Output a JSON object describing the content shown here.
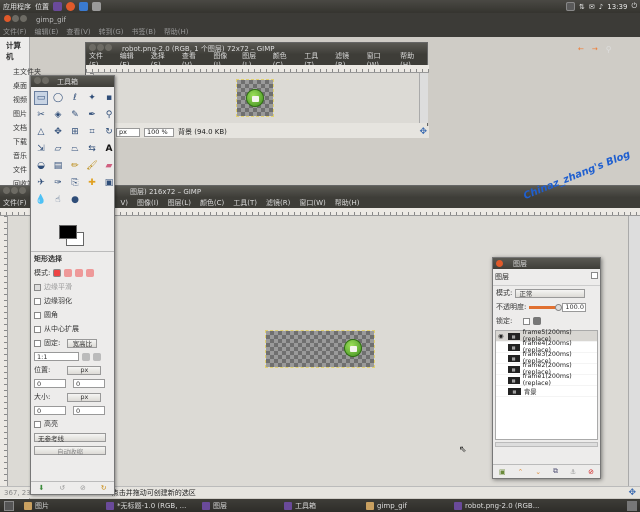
{
  "top_panel": {
    "apps": "应用程序",
    "places": "位置",
    "time": "13:39"
  },
  "bg_window": {
    "title": "gimp_gif",
    "menus": [
      "文件(F)",
      "编辑(E)",
      "查看(V)",
      "转到(G)",
      "书签(B)",
      "帮助(H)"
    ]
  },
  "file_manager": {
    "header": "计算机",
    "items": [
      "主文件夹",
      "桌面",
      "视频",
      "图片",
      "文档",
      "下载",
      "音乐",
      "文件",
      "回收站"
    ],
    "network": "网络"
  },
  "small_window": {
    "title": "robot.png-2.0 (RGB, 1 个图层) 72x72 – GIMP",
    "menus": [
      "文件(F)",
      "编辑(E)",
      "选择(S)",
      "查看(V)",
      "图像(I)",
      "图层(L)",
      "颜色(C)",
      "工具(T)",
      "滤镜(R)",
      "窗口(W)",
      "帮助(H)"
    ],
    "unit": "px",
    "zoom": "100 %",
    "status": "背景 (94.0 KB)"
  },
  "main_window": {
    "title": "图层) 216x72 – GIMP",
    "menus": [
      "文件(F)",
      "V)",
      "图像(I)",
      "图层(L)",
      "颜色(C)",
      "工具(T)",
      "滤镜(R)",
      "窗口(W)",
      "帮助(H)"
    ],
    "coords": "367, 23",
    "status": "点击并拖动可创建新的选区"
  },
  "watermark": "Chinaz_zhang's Blog",
  "toolbox": {
    "title": "工具箱",
    "colors": {
      "fg": "#000000",
      "bg": "#ffffff"
    },
    "options": {
      "title": "矩形选择",
      "mode": "模式:",
      "antialias": "边缘平滑",
      "feather": "边缘羽化",
      "rounded": "圆角",
      "expand": "从中心扩展",
      "fixed": "固定:",
      "fixed_value": "宽高比",
      "ratio": "1:1",
      "position": "位置:",
      "pos_unit": "px",
      "pos_x": "0",
      "pos_y": "0",
      "size": "大小:",
      "size_unit": "px",
      "size_w": "0",
      "size_h": "0",
      "highlight": "高亮",
      "guides": "无参考线",
      "autoshrink": "自动收缩"
    }
  },
  "layers_dock": {
    "title": "图层",
    "tab": "图层",
    "mode_label": "模式:",
    "mode_value": "正常",
    "opacity_label": "不透明度:",
    "opacity_value": "100.0",
    "opacity": 1.0,
    "lock_label": "锁定:",
    "layers": [
      "frame5(200ms)(replace)",
      "frame4(200ms)(replace)",
      "frame3(200ms)(replace)",
      "frame2(200ms)(replace)",
      "frame1(200ms)(replace)",
      "背景"
    ]
  },
  "taskbar": {
    "items": [
      "图片",
      "*无标题-1.0 (RGB, ...",
      "图层",
      "工具箱",
      "gimp_gif",
      "robot.png-2.0 (RGB..."
    ]
  }
}
